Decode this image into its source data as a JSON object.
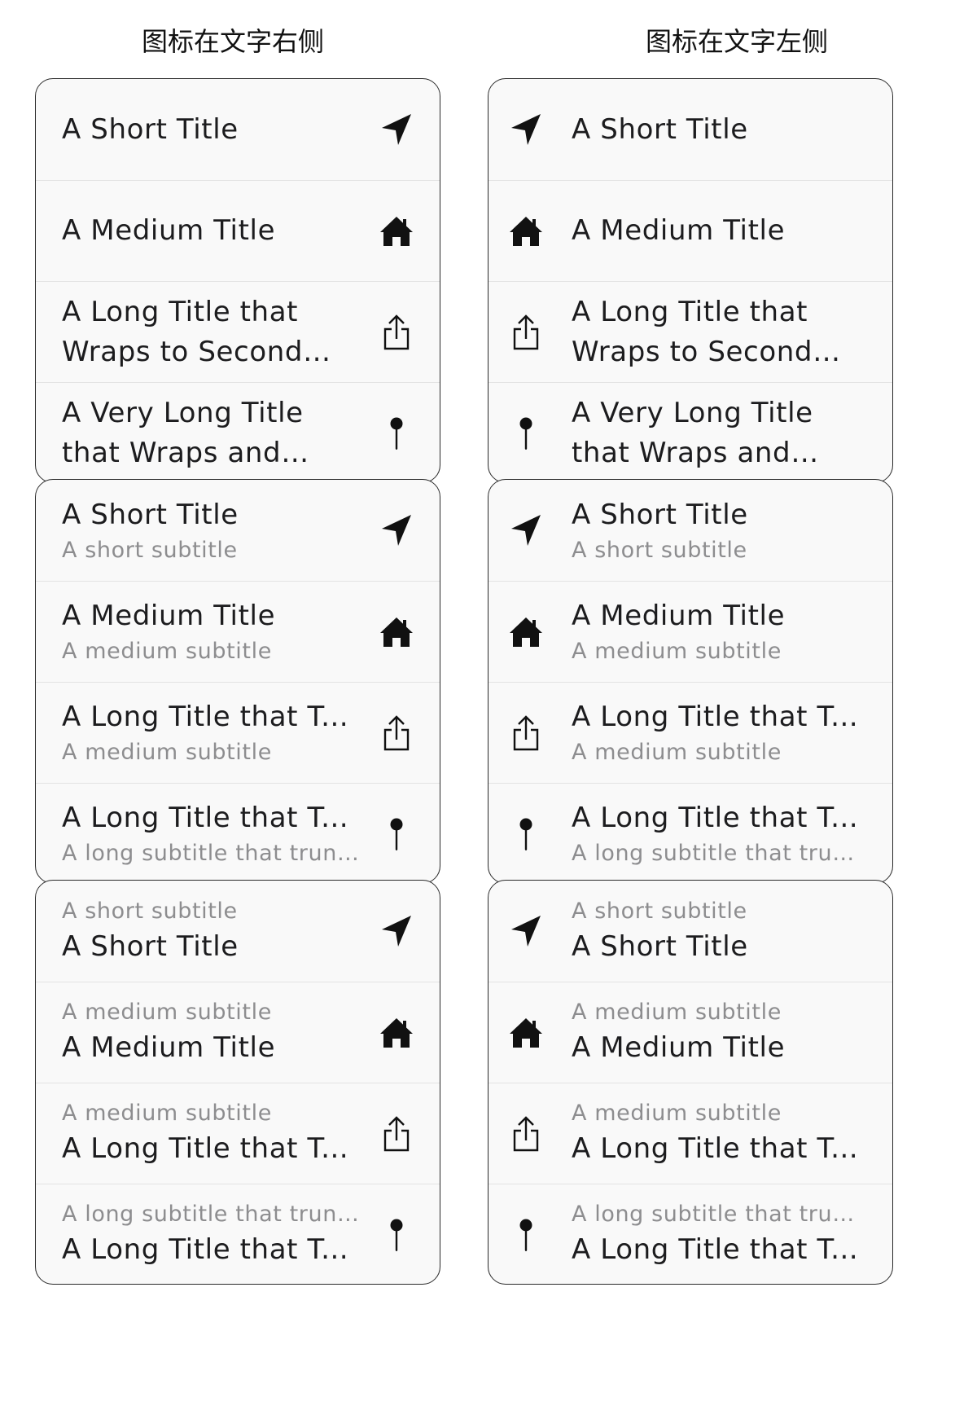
{
  "headers": {
    "icon_right": "图标在文字右侧",
    "icon_left": "图标在文字左侧"
  },
  "icons": [
    "location-arrow-icon",
    "house-icon",
    "share-icon",
    "pushpin-icon"
  ],
  "accent_color": "#1c1c1e",
  "subtitle_color": "#8d8d8f",
  "card1": {
    "titles": [
      "A Short Title",
      "A Medium Title",
      "A Long Title that Wraps to Second Row",
      "A Very Long Title that Wraps and Truncates Itself"
    ]
  },
  "card2": {
    "titles": [
      "A Short Title",
      "A Medium Title",
      "A Long Title that Truncates",
      "A Long Title that Truncates"
    ],
    "subtitles": [
      "A short subtitle",
      "A medium subtitle",
      "A medium subtitle",
      "A long subtitle that truncates"
    ]
  },
  "card3": {
    "subtitles": [
      "A short subtitle",
      "A medium subtitle",
      "A medium subtitle",
      "A long subtitle that truncates"
    ],
    "titles": [
      "A Short Title",
      "A Medium Title",
      "A Long Title that Truncates",
      "A Long Title that Truncates"
    ]
  }
}
